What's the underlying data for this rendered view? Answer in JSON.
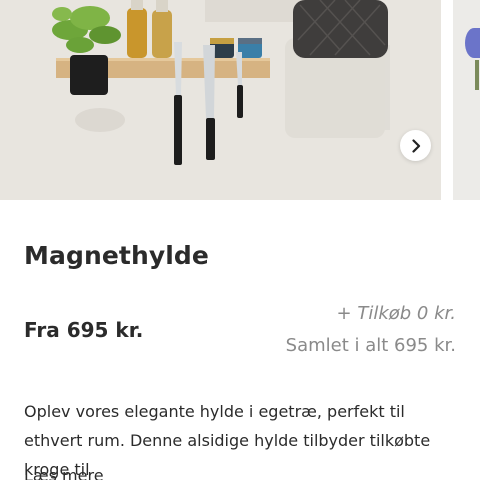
{
  "gallery": {
    "image_alt": "",
    "next_icon": "chevron-right-icon"
  },
  "product": {
    "title": "Magnethylde",
    "price": "Fra 695 kr.",
    "addon": "+ Tilkøb 0 kr.",
    "total": "Samlet i alt 695 kr.",
    "description": "Oplev vores elegante hylde i egetræ, perfekt til ethvert rum. Denne alsidige hylde tilbyder tilkøbte kroge til",
    "read_more": "Læs mere"
  }
}
